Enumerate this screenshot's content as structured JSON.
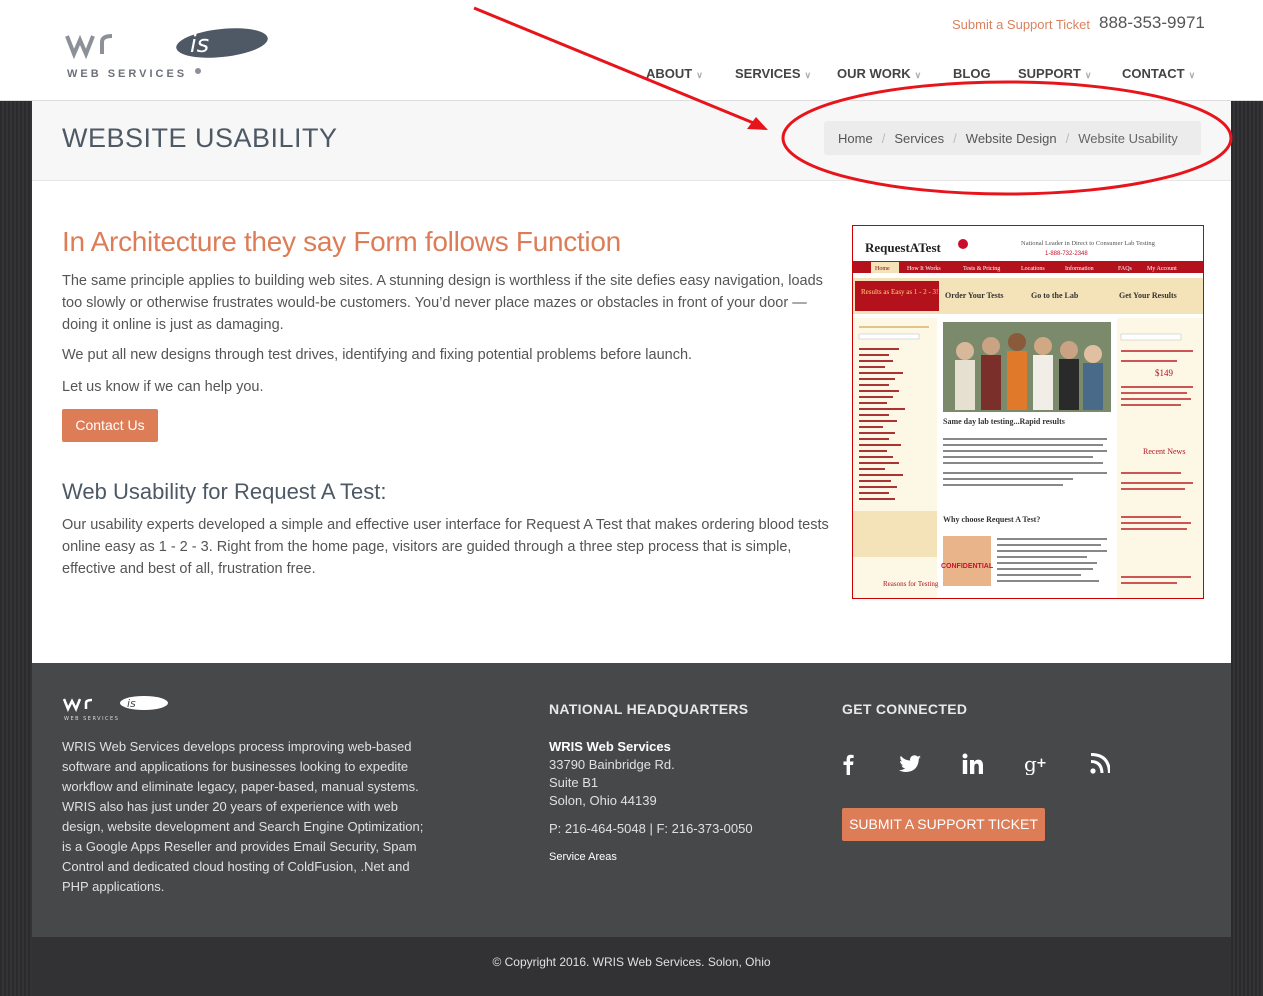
{
  "header": {
    "logo_text": "wris",
    "logo_sub": "WEB SERVICES",
    "support_link": "Submit a Support Ticket",
    "phone": "888-353-9971",
    "nav": [
      {
        "label": "ABOUT",
        "dropdown": true
      },
      {
        "label": "SERVICES",
        "dropdown": true
      },
      {
        "label": "OUR WORK",
        "dropdown": true
      },
      {
        "label": "BLOG",
        "dropdown": false
      },
      {
        "label": "SUPPORT",
        "dropdown": true
      },
      {
        "label": "CONTACT",
        "dropdown": true
      }
    ]
  },
  "page": {
    "title": "WEBSITE USABILITY",
    "breadcrumb": [
      "Home",
      "Services",
      "Website Design",
      "Website Usability"
    ],
    "heading": "In Architecture they say Form follows Function",
    "p1": "The same principle applies to building web sites. A stunning design is worthless if the site defies easy navigation, loads too slowly or otherwise frustrates would-be customers. You’d never place mazes or obstacles in front of your door — doing it online is just as damaging.",
    "p2": "We put all new designs through test drives, identifying and fixing potential problems before launch.",
    "p3": "Let us know if we can help you.",
    "contact_button": "Contact Us",
    "subheading": "Web Usability for Request A Test:",
    "p4": "Our usability experts developed a simple and effective user interface for Request A Test that makes ordering blood tests online easy as 1 - 2 - 3. Right from the home page, visitors are guided through a three step process that is simple, effective and best of all, frustration free."
  },
  "screenshot": {
    "brand": "RequestATest",
    "tagline": "National Leader in Direct to Consumer Lab Testing",
    "phone": "1-888-732-2348",
    "tabs": [
      "Home",
      "How It Works",
      "Tests & Pricing",
      "Locations",
      "Information",
      "FAQs",
      "My Account"
    ],
    "banner": "Results as Easy as 1 - 2 - 3!",
    "steps": [
      "Order Your Tests",
      "Go to the Lab",
      "Get Your Results"
    ],
    "headline": "Same day lab testing...Rapid results",
    "why": "Why choose Request A Test?",
    "news": "Recent News",
    "price": "$149",
    "confidential": "CONFIDENTIAL",
    "reasons": "Reasons for Testing"
  },
  "footer": {
    "about": "WRIS Web Services develops process improving web-based software and applications for businesses looking to expedite workflow and eliminate legacy, paper-based, manual systems. WRIS also has just under 20 years of experience with web design, website development and Search Engine Optimization; is a Google Apps Reseller and provides Email Security, Spam Control and dedicated cloud hosting of ColdFusion, .Net and PHP applications.",
    "hq_heading": "NATIONAL HEADQUARTERS",
    "company": "WRIS Web Services",
    "address1": "33790 Bainbridge Rd.",
    "address2": "Suite B1",
    "address3": "Solon, Ohio 44139",
    "phones": "P: 216-464-5048 | F: 216-373-0050",
    "service_areas": "Service Areas",
    "connect_heading": "GET CONNECTED",
    "social": [
      "facebook-icon",
      "twitter-icon",
      "linkedin-icon",
      "google-plus-icon",
      "rss-icon"
    ],
    "ticket_button": "SUBMIT A SUPPORT TICKET",
    "copyright": "© Copyright 2016. WRIS Web Services. Solon, Ohio"
  },
  "colors": {
    "accent": "#dd7d58",
    "title": "#4d5965",
    "footer_bg": "#47484a",
    "annotation": "#e8141b"
  }
}
